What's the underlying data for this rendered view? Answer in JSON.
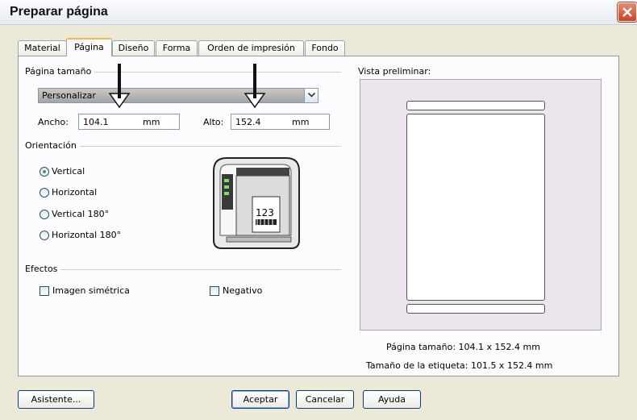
{
  "window": {
    "title": "Preparar página",
    "close_icon": "close-icon"
  },
  "tabs": [
    {
      "label": "Material"
    },
    {
      "label": "Página",
      "active": true
    },
    {
      "label": "Diseño"
    },
    {
      "label": "Forma"
    },
    {
      "label": "Orden de impresión"
    },
    {
      "label": "Fondo"
    }
  ],
  "page_size": {
    "group_label": "Página tamaño",
    "selected": "Personalizar",
    "width_label": "Ancho:",
    "width_value": "104.1",
    "width_unit": "mm",
    "height_label": "Alto:",
    "height_value": "152.4",
    "height_unit": "mm"
  },
  "orientation": {
    "group_label": "Orientación",
    "options": [
      "Vertical",
      "Horizontal",
      "Vertical 180°",
      "Horizontal 180°"
    ],
    "selected": "Vertical",
    "printer_label_text": "123"
  },
  "effects": {
    "group_label": "Efectos",
    "mirror_label": "Imagen simétrica",
    "mirror_checked": false,
    "negative_label": "Negativo",
    "negative_checked": false
  },
  "preview": {
    "label": "Vista preliminar:",
    "page_size_text": "Página tamaño:  104.1 x 152.4  mm",
    "label_size_text": "Tamaño de la etiqueta:  101.5 x 152.4  mm"
  },
  "buttons": {
    "wizard": "Asistente...",
    "ok": "Aceptar",
    "cancel": "Cancelar",
    "help": "Ayuda"
  },
  "colors": {
    "accent_tab": "#f7b64a",
    "close": "#c8452a",
    "radio_dot": "#2ea44a"
  }
}
